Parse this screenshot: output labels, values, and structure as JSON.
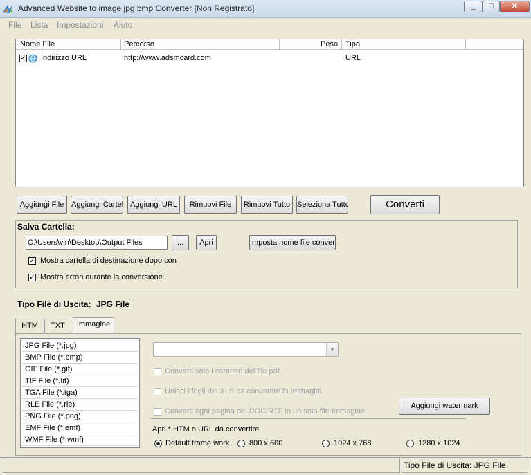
{
  "window": {
    "title": "Advanced Website to image jpg bmp Converter [Non Registrato]",
    "minimize": "_",
    "maximize": "□",
    "close": "✕"
  },
  "menu": [
    "File",
    "Lista",
    "Impostazioni",
    "Aiuto"
  ],
  "list": {
    "columns": [
      "Nome File",
      "Percorso",
      "Peso",
      "Tipo"
    ],
    "rows": [
      {
        "checked": true,
        "name": "Indirizzo URL",
        "path": "http://www.adsmcard.com",
        "size": "",
        "type": "URL"
      }
    ]
  },
  "buttons": {
    "add_file": "Aggiungi File",
    "add_folder": "Aggiungi Cartella",
    "add_url": "Aggiungi URL",
    "remove_file": "Rimuovi File",
    "remove_all": "Rimuovi Tutto",
    "select_all": "Seleziona Tutto",
    "convert": "Converti"
  },
  "save_folder": {
    "label": "Salva Cartella:",
    "path": "C:\\Users\\vin\\Desktop\\Output Files",
    "browse": "...",
    "open": "Apri",
    "set_name": "Imposta nome file convertiti",
    "opt_show_folder": "Mostra cartella di destinazione dopo con",
    "opt_show_errors": "Mostra errori durante la conversione"
  },
  "output_type": {
    "label": "Tipo File di Uscita:",
    "value": "JPG File"
  },
  "tabs": [
    "HTM",
    "TXT",
    "Immagine"
  ],
  "formats": [
    "JPG File  (*.jpg)",
    "BMP File  (*.bmp)",
    "GIF File  (*.gif)",
    "TIF File  (*.tif)",
    "TGA File  (*.tga)",
    "RLE File  (*.rle)",
    "PNG File  (*.png)",
    "EMF File  (*.emf)",
    "WMF File  (*.wmf)"
  ],
  "image_options": {
    "opt_pdf_chars": "Converti solo i caratteri del file pdf",
    "opt_xls_sheets": "Unisci i fogli del XLS da convertire in Immagini",
    "opt_doc_pages": "Converti ogni pagina del DOC/RTF in un solo file Immagine",
    "watermark": "Aggiungi watermark"
  },
  "open_section": {
    "label": "Apri *.HTM o URL da convertire",
    "radios": [
      "Default frame work",
      "800 x 600",
      "1024 x 768",
      "1280 x 1024"
    ]
  },
  "status": {
    "text": "Tipo File di Uscita:  JPG File"
  }
}
